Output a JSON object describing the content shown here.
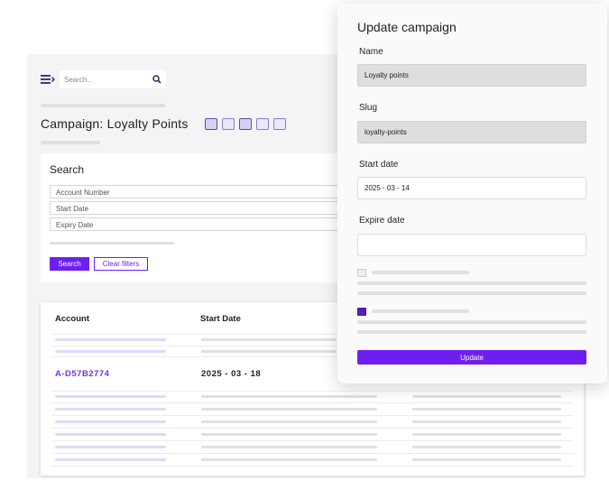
{
  "header": {
    "search_placeholder": "Search..."
  },
  "page": {
    "title": "Campaign: Loyalty Points"
  },
  "search_panel": {
    "title": "Search",
    "fields": [
      "Account Number",
      "Start Date",
      "Expiry Date"
    ],
    "search_label": "Search",
    "clear_label": "Clear filters"
  },
  "table": {
    "columns": [
      "Account",
      "Start Date"
    ],
    "rows": [
      {
        "account": "A-D57B2774",
        "start_date": "2025 - 03 - 18"
      }
    ]
  },
  "modal": {
    "title": "Update campaign",
    "name_label": "Name",
    "name_value": "Loyalty points",
    "slug_label": "Slug",
    "slug_value": "loyalty-points",
    "start_label": "Start date",
    "start_value": "2025 - 03 - 14",
    "expire_label": "Expire date",
    "expire_value": "",
    "checkbox_1_checked": false,
    "checkbox_2_checked": true,
    "update_label": "Update"
  },
  "colors": {
    "accent": "#6e1ff0",
    "link": "#7a2fe0"
  }
}
